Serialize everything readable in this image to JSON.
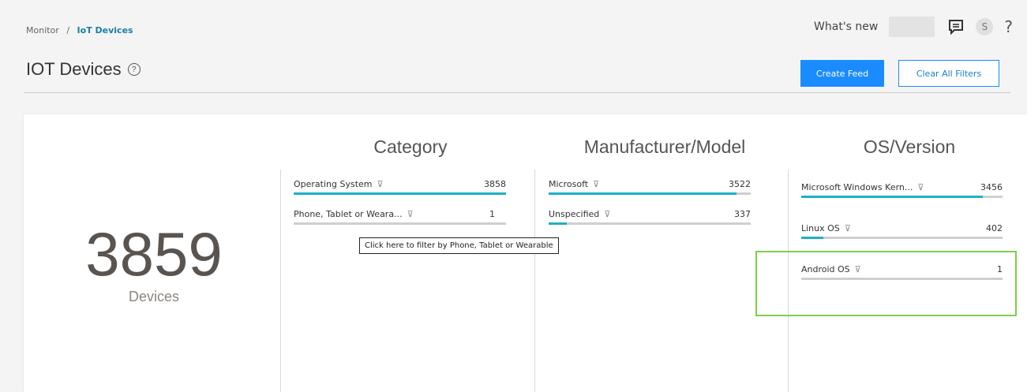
{
  "breadcrumb": {
    "root": "Monitor",
    "separator": "/",
    "current": "IoT Devices"
  },
  "header": {
    "whats_new": "What's new",
    "avatar_initial": "S",
    "help": "?"
  },
  "page": {
    "title": "IOT Devices",
    "title_help": "?",
    "create_feed": "Create Feed",
    "clear_filters": "Clear All Filters"
  },
  "summary": {
    "count": "3859",
    "label": "Devices"
  },
  "category": {
    "heading": "Category",
    "items": [
      {
        "label": "Operating System",
        "count": "3858",
        "fill": 1.0
      },
      {
        "label": "Phone, Tablet or Weara...",
        "count": "1",
        "fill": 0.0
      }
    ]
  },
  "manufacturer": {
    "heading": "Manufacturer/Model",
    "items": [
      {
        "label": "Microsoft",
        "count": "3522",
        "fill": 0.93
      },
      {
        "label": "Unspecified",
        "count": "337",
        "fill": 0.09
      }
    ]
  },
  "os": {
    "heading": "OS/Version",
    "items": [
      {
        "label": "Microsoft Windows Kern...",
        "count": "3456",
        "fill": 0.9
      },
      {
        "label": "Linux OS",
        "count": "402",
        "fill": 0.11
      },
      {
        "label": "Android OS",
        "count": "1",
        "fill": 0.0
      }
    ]
  },
  "tooltip": "Click here to filter by Phone, Tablet or Wearable",
  "colors": {
    "accent": "#1eb0c8",
    "primary": "#1a8cff",
    "highlight": "#7cd04a"
  },
  "icons": {
    "filter": "filter-icon",
    "notifications": "chat-icon",
    "help": "help-icon"
  }
}
